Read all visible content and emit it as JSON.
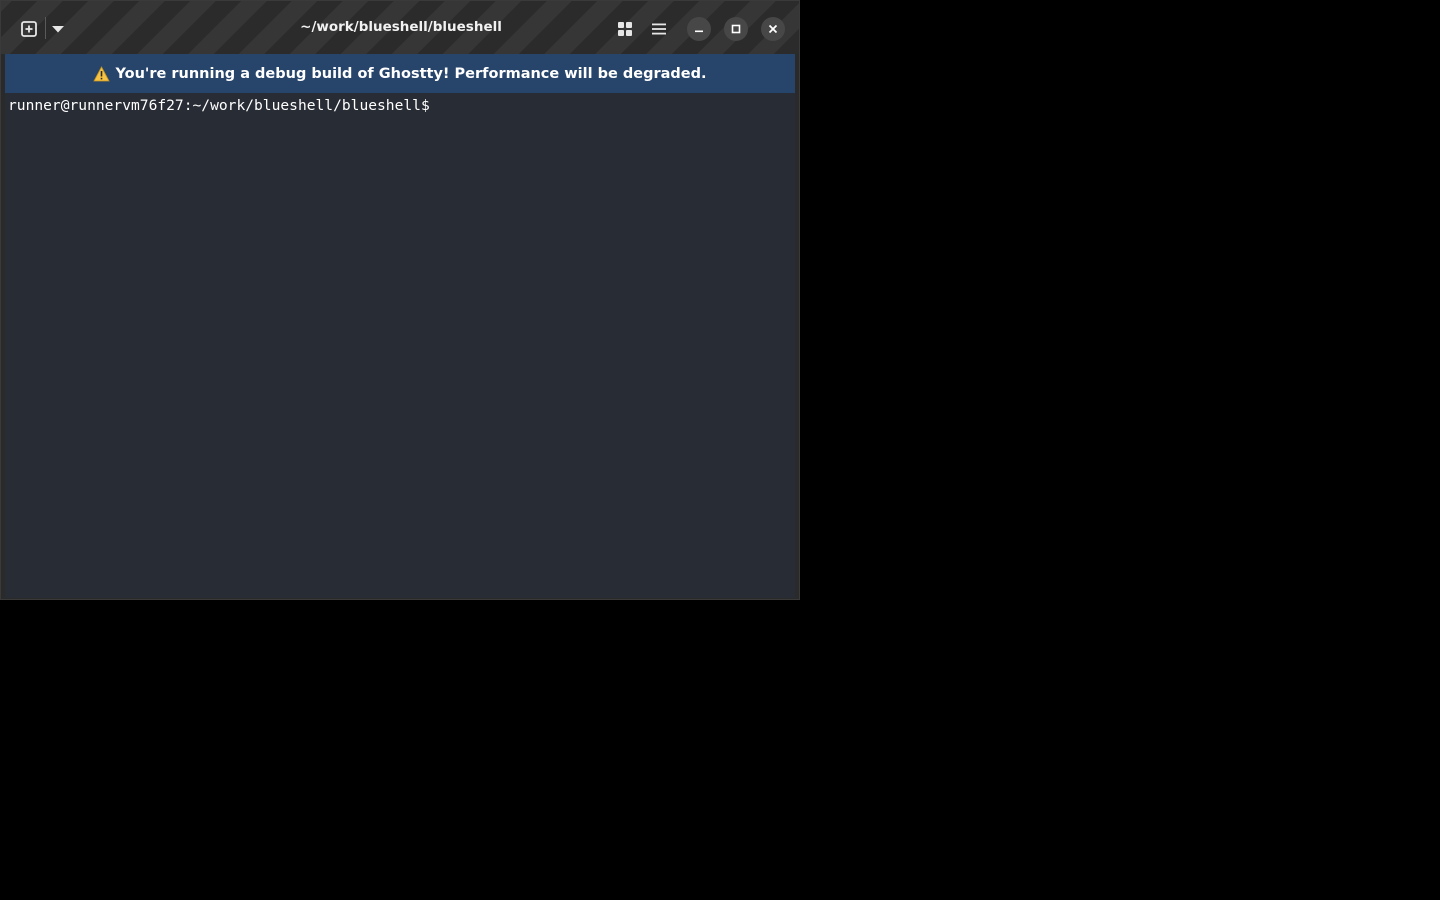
{
  "window": {
    "title": "~/work/blueshell/blueshell"
  },
  "headerbar": {
    "new_tab_icon": "new-tab-icon",
    "tab_dropdown_icon": "chevron-down-icon",
    "overview_icon": "tab-overview-icon",
    "menu_icon": "hamburger-menu-icon",
    "minimize_icon": "minimize-icon",
    "maximize_icon": "maximize-icon",
    "close_icon": "close-icon"
  },
  "banner": {
    "icon": "warning-icon",
    "text": "You're running a debug build of Ghostty! Performance will be degraded."
  },
  "terminal": {
    "prompt": "runner@runnervm76f27:~/work/blueshell/blueshell$"
  },
  "colors": {
    "banner_bg": "#27446b",
    "terminal_bg": "#282c34",
    "headerbar_bg": "#2e2e2e",
    "warning_icon": "#f6c344"
  }
}
